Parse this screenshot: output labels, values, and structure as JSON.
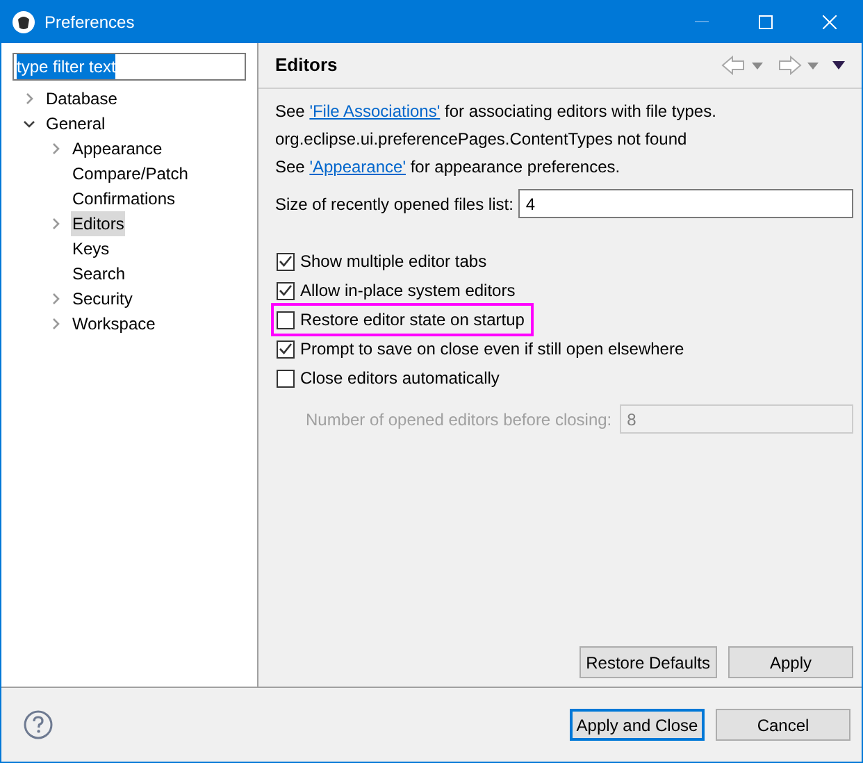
{
  "window": {
    "title": "Preferences"
  },
  "filter": {
    "value": "type filter text",
    "selected": true
  },
  "tree": [
    {
      "label": "Database",
      "expanded": false,
      "selected": false
    },
    {
      "label": "General",
      "expanded": true,
      "selected": false,
      "children": [
        {
          "label": "Appearance",
          "expanded": false,
          "selected": false
        },
        {
          "label": "Compare/Patch",
          "selected": false
        },
        {
          "label": "Confirmations",
          "selected": false
        },
        {
          "label": "Editors",
          "expanded": false,
          "selected": true
        },
        {
          "label": "Keys",
          "selected": false
        },
        {
          "label": "Search",
          "selected": false
        },
        {
          "label": "Security",
          "expanded": false,
          "selected": false
        },
        {
          "label": "Workspace",
          "expanded": false,
          "selected": false
        }
      ]
    }
  ],
  "page": {
    "title": "Editors",
    "info_lines": [
      {
        "kind": "link",
        "before": "See",
        "link": "'File Associations'",
        "after": "for associating editors with file types."
      },
      {
        "kind": "text",
        "text": "org.eclipse.ui.preferencePages.ContentTypes not found"
      },
      {
        "kind": "link",
        "before": "See",
        "link": "'Appearance'",
        "after": "for appearance preferences."
      }
    ],
    "recent_files": {
      "label": "Size of recently opened files list:",
      "value": "4"
    },
    "checkboxes": [
      {
        "label": "Show multiple editor tabs",
        "checked": true,
        "highlighted": false
      },
      {
        "label": "Allow in-place system editors",
        "checked": true,
        "highlighted": false
      },
      {
        "label": "Restore editor state on startup",
        "checked": false,
        "highlighted": true
      },
      {
        "label": "Prompt to save on close even if still open elsewhere",
        "checked": true,
        "highlighted": false
      },
      {
        "label": "Close editors automatically",
        "checked": false,
        "highlighted": false
      }
    ],
    "editors_count": {
      "label": "Number of opened editors before closing:",
      "value": "8",
      "disabled": true
    },
    "buttons": [
      "Restore Defaults",
      "Apply"
    ]
  },
  "footer": {
    "buttons": [
      {
        "label": "Apply and Close",
        "default": true
      },
      {
        "label": "Cancel",
        "default": false
      }
    ]
  }
}
